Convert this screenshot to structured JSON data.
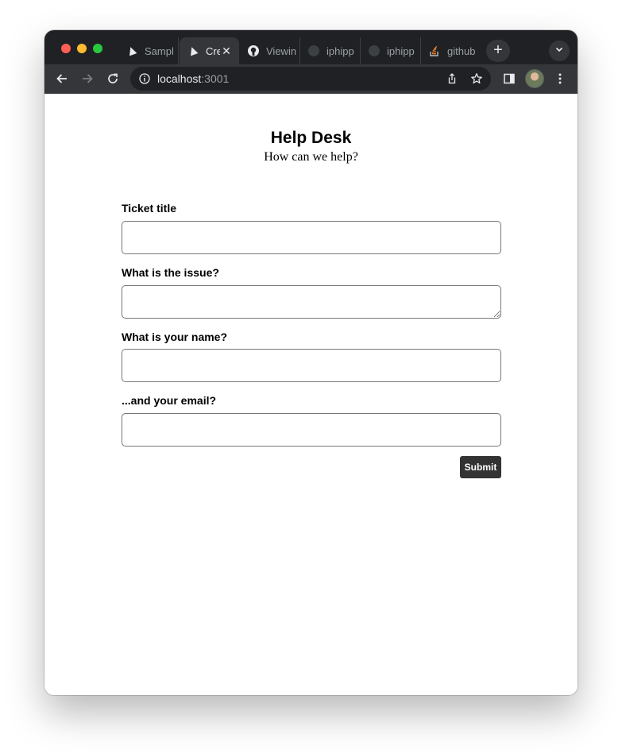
{
  "browser": {
    "tabs": [
      {
        "label": "Sampl",
        "icon": "vercel-icon",
        "active": false
      },
      {
        "label": "Cre",
        "icon": "vercel-icon",
        "active": true
      },
      {
        "label": "Viewin",
        "icon": "github-icon",
        "active": false
      },
      {
        "label": "iphipp",
        "icon": "github-icon",
        "active": false
      },
      {
        "label": "iphipp",
        "icon": "github-icon",
        "active": false
      },
      {
        "label": "github",
        "icon": "stackoverflow-icon",
        "active": false
      }
    ],
    "new_tab": "+",
    "close_glyph": "✕",
    "address": {
      "host": "localhost",
      "port": ":3001"
    },
    "colors": {
      "tabstrip": "#202124",
      "toolbar": "#35363a",
      "accent_stackoverflow": "#f48024"
    }
  },
  "page": {
    "title": "Help Desk",
    "subtitle": "How can we help?",
    "fields": [
      {
        "label": "Ticket title",
        "value": "",
        "type": "input"
      },
      {
        "label": "What is the issue?",
        "value": "",
        "type": "textarea"
      },
      {
        "label": "What is your name?",
        "value": "",
        "type": "input"
      },
      {
        "label": "...and your email?",
        "value": "",
        "type": "input"
      }
    ],
    "submit_label": "Submit"
  }
}
